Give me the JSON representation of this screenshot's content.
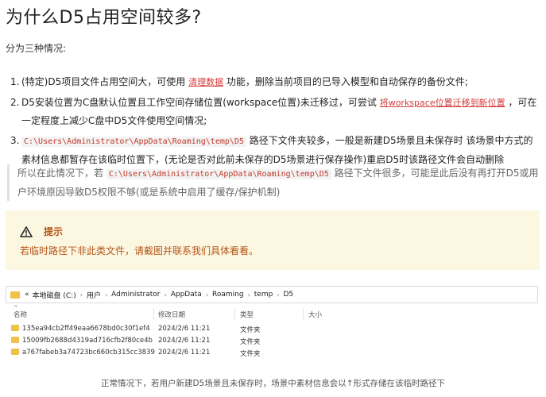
{
  "title": "为什么D5占用空间较多?",
  "intro": "分为三种情况:",
  "items": [
    {
      "num": "1.",
      "pre": "(特定)D5项目文件占用空间大，可使用",
      "link": "清理数据",
      "post": "功能，删除当前项目的已导入模型和自动保存的备份文件;"
    },
    {
      "num": "2.",
      "pre": "D5安装位置为C盘默认位置且工作空间存储位置(workspace位置)未迁移过，可尝试",
      "link": "将workspace位置迁移到新位置",
      "post": "，可在一定程度上减少C盘中D5文件使用空间情况;"
    },
    {
      "num": "3.",
      "code": "C:\\Users\\Administrator\\AppData\\Roaming\\temp\\D5",
      "post": "路径下文件夹较多，一般是新建D5场景且未保存时 该场景中方式的素材信息都暂存在该临时位置下，(无论是否对此前未保存的D5场景进行保存操作)重启D5时该路径文件会自动删除"
    }
  ],
  "quote": {
    "pre": "所以在此情况下，若",
    "code": "C:\\Users\\Administrator\\AppData\\Roaming\\temp\\D5",
    "post": "路径下文件很多，可能是此后没有再打开D5或用户环境原因导致D5权限不够(或是系统中启用了缓存/保护机制)"
  },
  "note": {
    "heading": "提示",
    "text": "若临时路径下非此类文件，请截图并联系我们具体看看。",
    "icon": "warning-icon"
  },
  "explorer": {
    "prefix": "«",
    "crumbs": [
      "本地磁盘 (C:)",
      "用户",
      "Administrator",
      "AppData",
      "Roaming",
      "temp",
      "D5"
    ],
    "columns": [
      "名称",
      "修改日期",
      "类型",
      "大小"
    ],
    "rows": [
      {
        "name": "135ea94cb2ff49eaa6678bd0c30f1ef4",
        "date": "2024/2/6 11:21",
        "type": "文件夹"
      },
      {
        "name": "15009fb2688d4319ad716cfb2f80ce4b",
        "date": "2024/2/6 11:21",
        "type": "文件夹"
      },
      {
        "name": "a767fabeb3a74723bc660cb315cc3839",
        "date": "2024/2/6 11:21",
        "type": "文件夹"
      }
    ]
  },
  "caption": "正常情况下，若用户新建D5场景且未保存时，场景中素材信息会以↑形式存储在该临时路径下"
}
